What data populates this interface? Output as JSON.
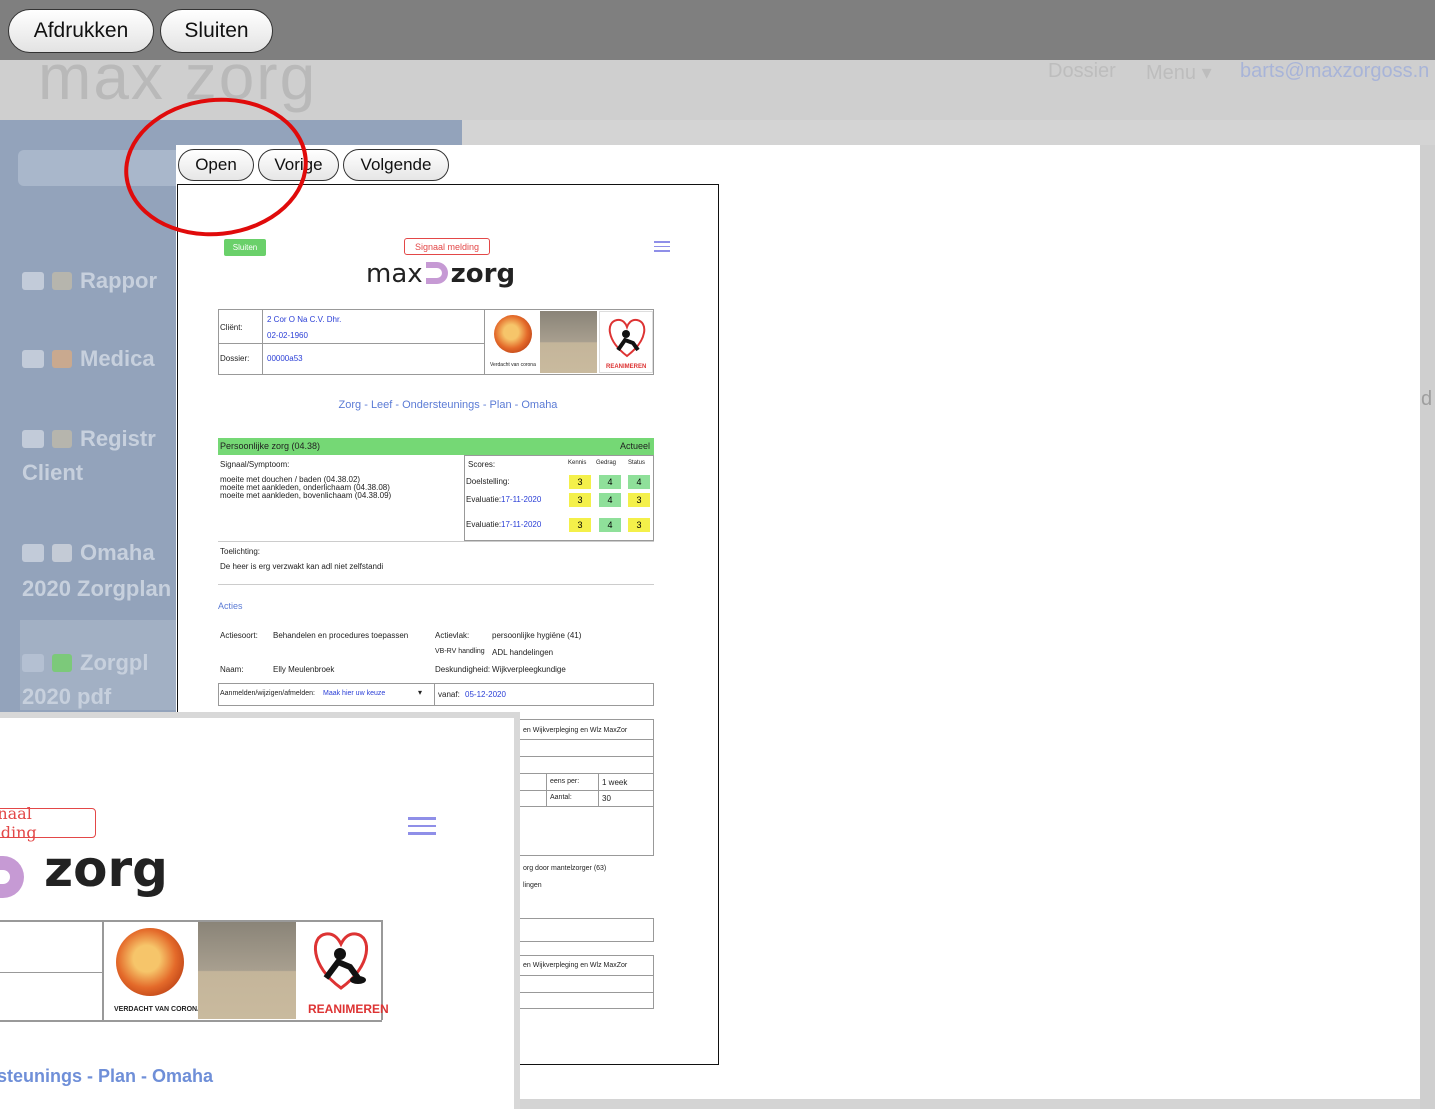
{
  "toolbar": {
    "print_label": "Afdrukken",
    "close_label": "Sluiten"
  },
  "background": {
    "logo": "max zorg",
    "nav": {
      "dossier": "Dossier",
      "menu": "Menu ▾",
      "user": "barts@maxzorgoss.n"
    },
    "sidebar": [
      {
        "label": "Rappor"
      },
      {
        "label": "Medica"
      },
      {
        "label": "Registr"
      },
      {
        "label": "Client"
      },
      {
        "label": "Omaha"
      },
      {
        "label": "2020 Zorgplan"
      },
      {
        "label": "Zorgpl"
      },
      {
        "label": "2020 pdf"
      }
    ],
    "right_letter": "d"
  },
  "viewer": {
    "open_label": "Open",
    "prev_label": "Vorige",
    "next_label": "Volgende"
  },
  "document": {
    "sluiten_label": "Sluiten",
    "signaal_label": "Signaal melding",
    "logo_max": "max",
    "logo_zorg": "zorg",
    "client_label": "Cliënt:",
    "client_name": "2 Cor O Na C.V. Dhr.",
    "client_dob": "02-02-1960",
    "dossier_label": "Dossier:",
    "dossier_id": "00000a53",
    "corona_caption": "Verdacht van corona",
    "reanimeren": "REANIMEREN",
    "plan_title": "Zorg - Leef - Ondersteunings - Plan - Omaha",
    "section_name": "Persoonlijke zorg (04.38)",
    "section_status": "Actueel",
    "signaal_header": "Signaal/Symptoom:",
    "symptoms": [
      "moeite met douchen / baden (04.38.02)",
      "moeite met aankleden, onderlichaam (04.38.08)",
      "moeite met aankleden, bovenlichaam (04.38.09)"
    ],
    "scores_header": "Scores:",
    "score_cols": [
      "Kennis",
      "Gedrag",
      "Status"
    ],
    "score_rows": [
      {
        "label": "Doelstelling:",
        "date": "",
        "values": [
          "3",
          "4",
          "4"
        ],
        "colors": [
          "#f4f04a",
          "#8fe09a",
          "#8fe09a"
        ]
      },
      {
        "label": "Evaluatie:",
        "date": "17-11-2020",
        "values": [
          "3",
          "4",
          "3"
        ],
        "colors": [
          "#f4f04a",
          "#8fe09a",
          "#f4f04a"
        ]
      },
      {
        "label": "Evaluatie:",
        "date": "17-11-2020",
        "values": [
          "3",
          "4",
          "3"
        ],
        "colors": [
          "#f4f04a",
          "#8fe09a",
          "#f4f04a"
        ]
      }
    ],
    "toelichting_label": "Toelichting:",
    "toelichting_text": "De heer is erg verzwakt kan adl niet zelfstandi",
    "acties_label": "Acties",
    "actiesoort_label": "Actiesoort:",
    "actiesoort_value": "Behandelen en procedures toepassen",
    "actievlak_label": "Actievlak:",
    "actievlak_value": "persoonlijke hygiëne (41)",
    "vbrv_label": "VB-RV handling",
    "vbrv_value": "ADL handelingen",
    "naam_label": "Naam:",
    "naam_value": "Elly Meulenbroek",
    "deskundigheid_label": "Deskundigheid:",
    "deskundigheid_value": "Wijkverpleegkundige",
    "aanmelden_label": "Aanmelden/wijzigen/afmelden:",
    "aanmelden_value": "Maak hier uw keuze",
    "vanaf_label": "vanaf:",
    "vanaf_value": "05-12-2020",
    "row_wijk1": "en Wijkverpleging en Wlz MaxZor",
    "eens_per_label": "eens per:",
    "eens_per_value": "1 week",
    "aantal_label": "Aantal:",
    "aantal_value": "30",
    "mantelzorg": "org door mantelzorger (63)",
    "lingen": "lingen",
    "row_wijk2": "en Wijkverpleging en Wlz MaxZor"
  },
  "zoom": {
    "signaal_label": "Signaal melding",
    "logo_zorg": "zorg",
    "corona_caption": "VERDACHT VAN CORONA",
    "reanimeren": "REANIMEREN",
    "plan_fragment": "ersteunings - Plan - Omaha"
  },
  "annotation": {
    "color": "#e00b0b"
  }
}
